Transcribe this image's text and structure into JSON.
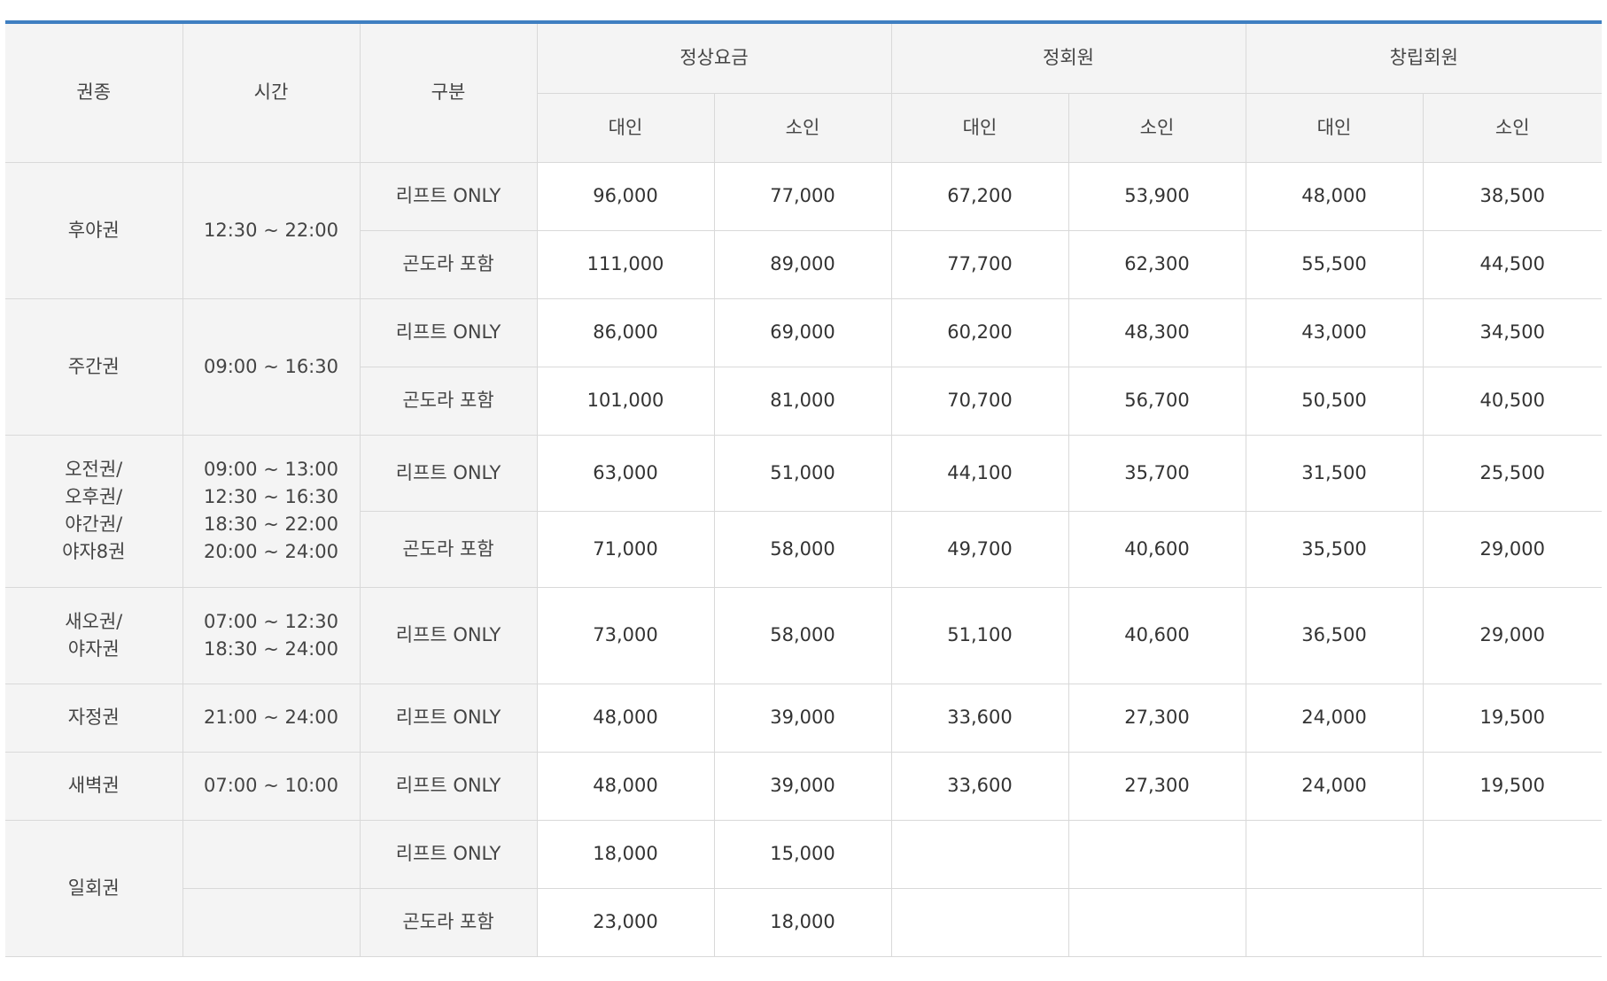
{
  "headers": {
    "ticket_type": "권종",
    "time": "시간",
    "category": "구분",
    "regular": "정상요금",
    "member": "정회원",
    "founding": "창립회원",
    "adult": "대인",
    "child": "소인"
  },
  "rows": [
    {
      "name": "후야권",
      "time": "12:30 ~ 22:00",
      "items": [
        {
          "cat": "리프트 ONLY",
          "values": [
            "96,000",
            "77,000",
            "67,200",
            "53,900",
            "48,000",
            "38,500"
          ]
        },
        {
          "cat": "곤도라 포함",
          "values": [
            "111,000",
            "89,000",
            "77,700",
            "62,300",
            "55,500",
            "44,500"
          ]
        }
      ]
    },
    {
      "name": "주간권",
      "time": "09:00 ~ 16:30",
      "items": [
        {
          "cat": "리프트 ONLY",
          "values": [
            "86,000",
            "69,000",
            "60,200",
            "48,300",
            "43,000",
            "34,500"
          ]
        },
        {
          "cat": "곤도라 포함",
          "values": [
            "101,000",
            "81,000",
            "70,700",
            "56,700",
            "50,500",
            "40,500"
          ]
        }
      ]
    },
    {
      "name_lines": [
        "오전권/",
        "오후권/",
        "야간권/",
        "야자8권"
      ],
      "time_lines": [
        "09:00 ~ 13:00",
        "12:30 ~ 16:30",
        "18:30 ~ 22:00",
        "20:00 ~ 24:00"
      ],
      "items": [
        {
          "cat": "리프트 ONLY",
          "values": [
            "63,000",
            "51,000",
            "44,100",
            "35,700",
            "31,500",
            "25,500"
          ]
        },
        {
          "cat": "곤도라 포함",
          "values": [
            "71,000",
            "58,000",
            "49,700",
            "40,600",
            "35,500",
            "29,000"
          ]
        }
      ]
    },
    {
      "name_lines": [
        "새오권/",
        "야자권"
      ],
      "time_lines": [
        "07:00 ~ 12:30",
        "18:30 ~ 24:00"
      ],
      "items": [
        {
          "cat": "리프트 ONLY",
          "values": [
            "73,000",
            "58,000",
            "51,100",
            "40,600",
            "36,500",
            "29,000"
          ]
        }
      ]
    },
    {
      "name": "자정권",
      "time": "21:00 ~ 24:00",
      "items": [
        {
          "cat": "리프트 ONLY",
          "values": [
            "48,000",
            "39,000",
            "33,600",
            "27,300",
            "24,000",
            "19,500"
          ]
        }
      ]
    },
    {
      "name": "새벽권",
      "time": "07:00 ~ 10:00",
      "items": [
        {
          "cat": "리프트 ONLY",
          "values": [
            "48,000",
            "39,000",
            "33,600",
            "27,300",
            "24,000",
            "19,500"
          ]
        }
      ]
    },
    {
      "name": "일회권",
      "items": [
        {
          "cat": "리프트 ONLY",
          "values": [
            "18,000",
            "15,000"
          ]
        },
        {
          "cat": "곤도라 포함",
          "values": [
            "23,000",
            "18,000"
          ]
        }
      ]
    }
  ]
}
